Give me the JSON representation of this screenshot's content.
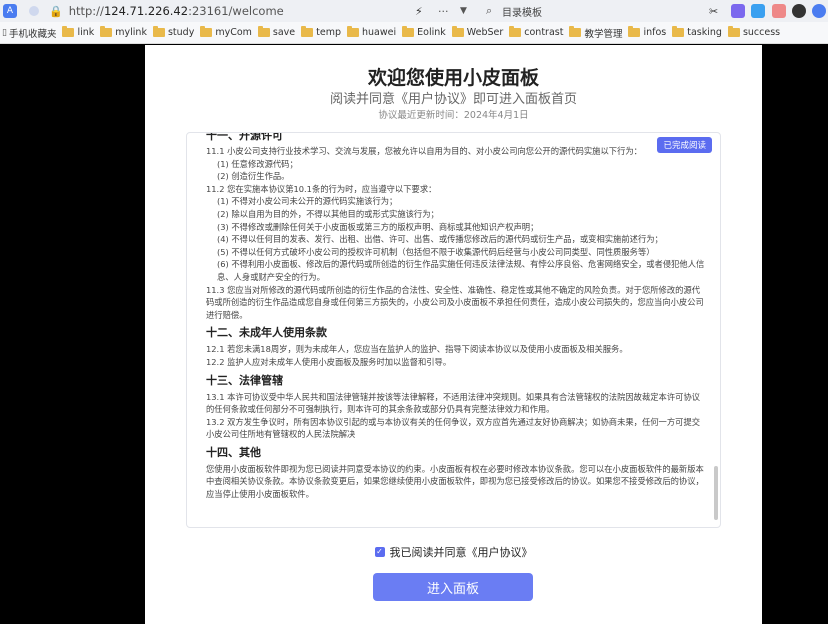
{
  "browser": {
    "url_prefix": "http://",
    "url_host": "124.71.226.42",
    "url_rest": ":23161/welcome",
    "search_placeholder": "目录模板",
    "bookmarks": [
      "手机收藏夹",
      "link",
      "mylink",
      "study",
      "myCom",
      "save",
      "temp",
      "huawei",
      "Eolink",
      "WebSer",
      "contrast",
      "教学管理",
      "infos",
      "tasking",
      "success"
    ]
  },
  "page": {
    "title": "欢迎您使用小皮面板",
    "subtitle": "阅读并同意《用户协议》即可进入面板首页",
    "updated": "协议最近更新时间：2024年4月1日",
    "badge": "已完成阅读",
    "agree_label": "我已阅读并同意《用户协议》",
    "enter_button": "进入面板"
  },
  "agreement": {
    "s11_title": "十一、开源许可",
    "s11_1": "11.1 小皮公司支持行业技术学习、交流与发展，您被允许以自用为目的、对小皮公司向您公开的源代码实施以下行为：",
    "s11_1a": "(1) 任意修改源代码；",
    "s11_1b": "(2) 创造衍生作品。",
    "s11_2": "11.2 您在实施本协议第10.1条的行为时，应当遵守以下要求：",
    "s11_2a": "(1) 不得对小皮公司未公开的源代码实施该行为；",
    "s11_2b": "(2) 除以自用为目的外，不得以其他目的或形式实施该行为；",
    "s11_2c": "(3) 不得修改或删除任何关于小皮面板或第三方的版权声明、商标或其他知识产权声明；",
    "s11_2d": "(4) 不得以任何目的发表、发行、出租、出借、许可、出售、或传播您修改后的源代码或衍生产品，或变相实施前述行为；",
    "s11_2e": "(5) 不得以任何方式破坏小皮公司的授权许可机制（包括但不限于收集源代码后经营与小皮公司同类型、同性质服务等）",
    "s11_2f": "(6) 不得利用小皮面板、修改后的源代码或所创造的衍生作品实施任何违反法律法规、有悖公序良俗、危害网络安全，或者侵犯他人信息、人身或财产安全的行为。",
    "s11_3": "11.3 您应当对所修改的源代码或所创造的衍生作品的合法性、安全性、准确性、稳定性或其他不确定的风险负责。对于您所修改的源代码或所创造的衍生作品造成您自身或任何第三方损失的，小皮公司及小皮面板不承担任何责任，造成小皮公司损失的，您应当向小皮公司进行赔偿。",
    "s12_title": "十二、未成年人使用条款",
    "s12_1": "12.1 若您未满18周岁，则为未成年人，您应当在监护人的监护、指导下阅读本协议以及使用小皮面板及相关服务。",
    "s12_2": "12.2 监护人应对未成年人使用小皮面板及服务时加以监督和引导。",
    "s13_title": "十三、法律管辖",
    "s13_1": "13.1 本许可协议受中华人民共和国法律管辖并按该等法律解释，不适用法律冲突规则。如果具有合法管辖权的法院因故裁定本许可协议的任何条款或任何部分不可强制执行，则本许可的其余条款或部分仍具有完整法律效力和作用。",
    "s13_2": "13.2 双方发生争议时，所有因本协议引起的或与本协议有关的任何争议，双方应首先通过友好协商解决；如协商未果，任何一方可提交小皮公司住所地有管辖权的人民法院解决",
    "s14_title": "十四、其他",
    "s14_1": "您使用小皮面板软件即视为您已阅读并同意受本协议的约束。小皮面板有权在必要时修改本协议条款。您可以在小皮面板软件的最新版本中查阅相关协议条款。本协议条款变更后，如果您继续使用小皮面板软件，即视为您已接受修改后的协议。如果您不接受修改后的协议，应当停止使用小皮面板软件。"
  }
}
